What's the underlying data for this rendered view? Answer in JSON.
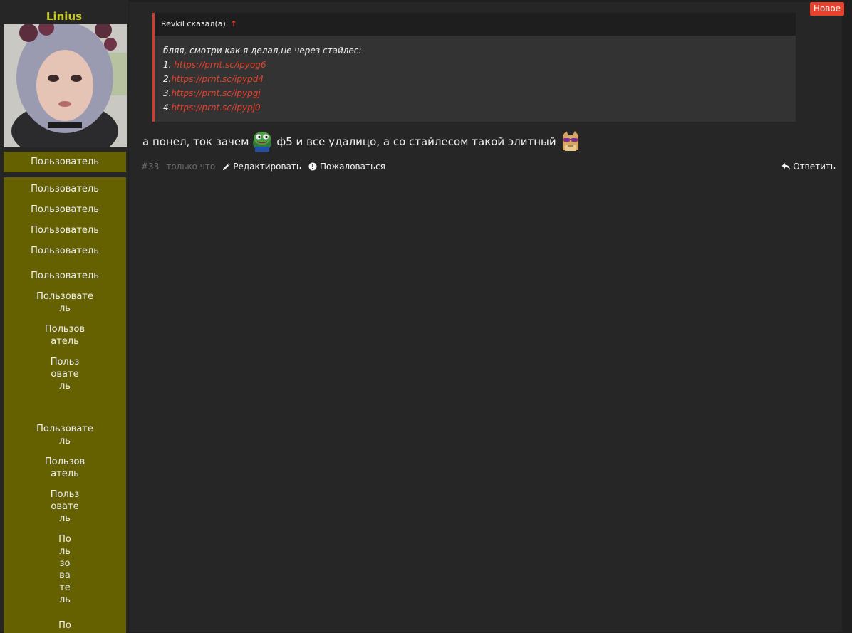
{
  "user": {
    "name": "Linius",
    "role_label": "Пользователь",
    "stacked_role_labels": [
      "Пользователь",
      "Пользователь",
      "Пользователь",
      "Пользователь",
      "Пользователь",
      "Пользовате\nль",
      "Пользов\nатель",
      "Польз\nовате\nль",
      "Пользовате\nль",
      "Пользов\nатель",
      "Польз\nовате\nль",
      "По\nль\nзо\nва\nте\nль",
      "По"
    ]
  },
  "badge": {
    "new": "Новое"
  },
  "quote": {
    "author_line": "Revkil сказал(а):",
    "arrow": "↑",
    "intro": "бляя, смотри как я делал,не через стайлес:",
    "items": [
      {
        "prefix": "1. ",
        "link": "https://prnt.sc/ipyog6"
      },
      {
        "prefix": "2.",
        "link": "https://prnt.sc/ipypd4"
      },
      {
        "prefix": "3.",
        "link": "https://prnt.sc/ipypgj"
      },
      {
        "prefix": "4.",
        "link": "https://prnt.sc/ipypj0"
      }
    ]
  },
  "post": {
    "text_part1": "а понел, ток зачем",
    "text_part2": "ф5 и все удалицо, а со стайлесом такой элитный",
    "emoji1": "pepe-frog-icon",
    "emoji2": "cool-cat-sunglasses-icon"
  },
  "footer": {
    "number": "#33",
    "time": "только что",
    "edit": "Редактировать",
    "report": "Пожаловаться",
    "reply": "Ответить"
  },
  "colors": {
    "accent": "#e8412c",
    "username": "#c6c91f",
    "role_bg": "#666100",
    "panel_bg": "#262626",
    "quote_bg": "#333333"
  }
}
